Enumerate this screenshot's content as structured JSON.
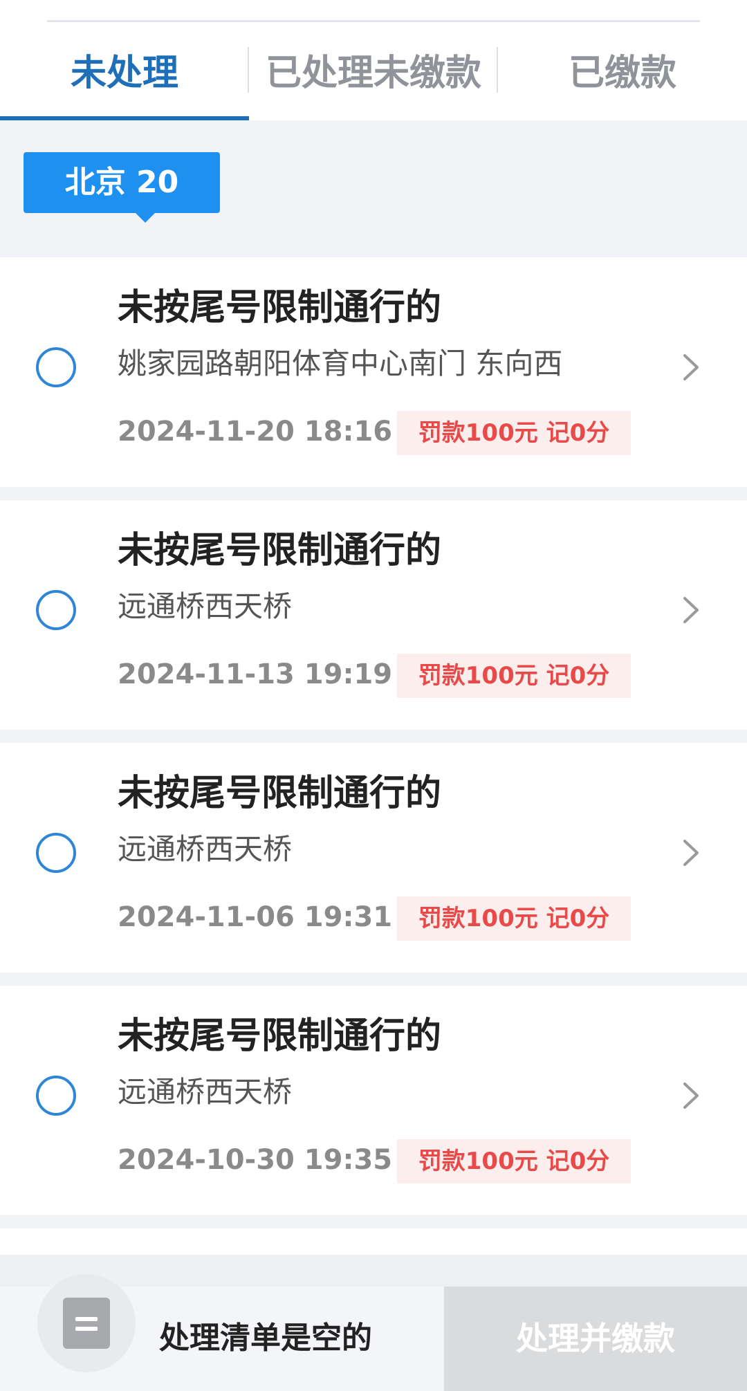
{
  "tabs": [
    {
      "label": "未处理",
      "active": true
    },
    {
      "label": "已处理未缴款",
      "active": false
    },
    {
      "label": "已缴款",
      "active": false
    }
  ],
  "plate": {
    "label": "北京 20"
  },
  "violations": [
    {
      "title": "未按尾号限制通行的",
      "location": "姚家园路朝阳体育中心南门 东向西",
      "time": "2024-11-20 18:16",
      "penalty": "罚款100元 记0分"
    },
    {
      "title": "未按尾号限制通行的",
      "location": "远通桥西天桥",
      "time": "2024-11-13 19:19",
      "penalty": "罚款100元 记0分"
    },
    {
      "title": "未按尾号限制通行的",
      "location": "远通桥西天桥",
      "time": "2024-11-06 19:31",
      "penalty": "罚款100元 记0分"
    },
    {
      "title": "未按尾号限制通行的",
      "location": "远通桥西天桥",
      "time": "2024-10-30 19:35",
      "penalty": "罚款100元 记0分"
    }
  ],
  "footer": {
    "empty_label": "处理清单是空的",
    "pay_button_label": "处理并缴款",
    "icon": "document-icon"
  },
  "colors": {
    "accent": "#1f6fb8",
    "plate_bg": "#1e90f0",
    "penalty_text": "#e84a4a",
    "penalty_bg": "#fdeeee"
  }
}
